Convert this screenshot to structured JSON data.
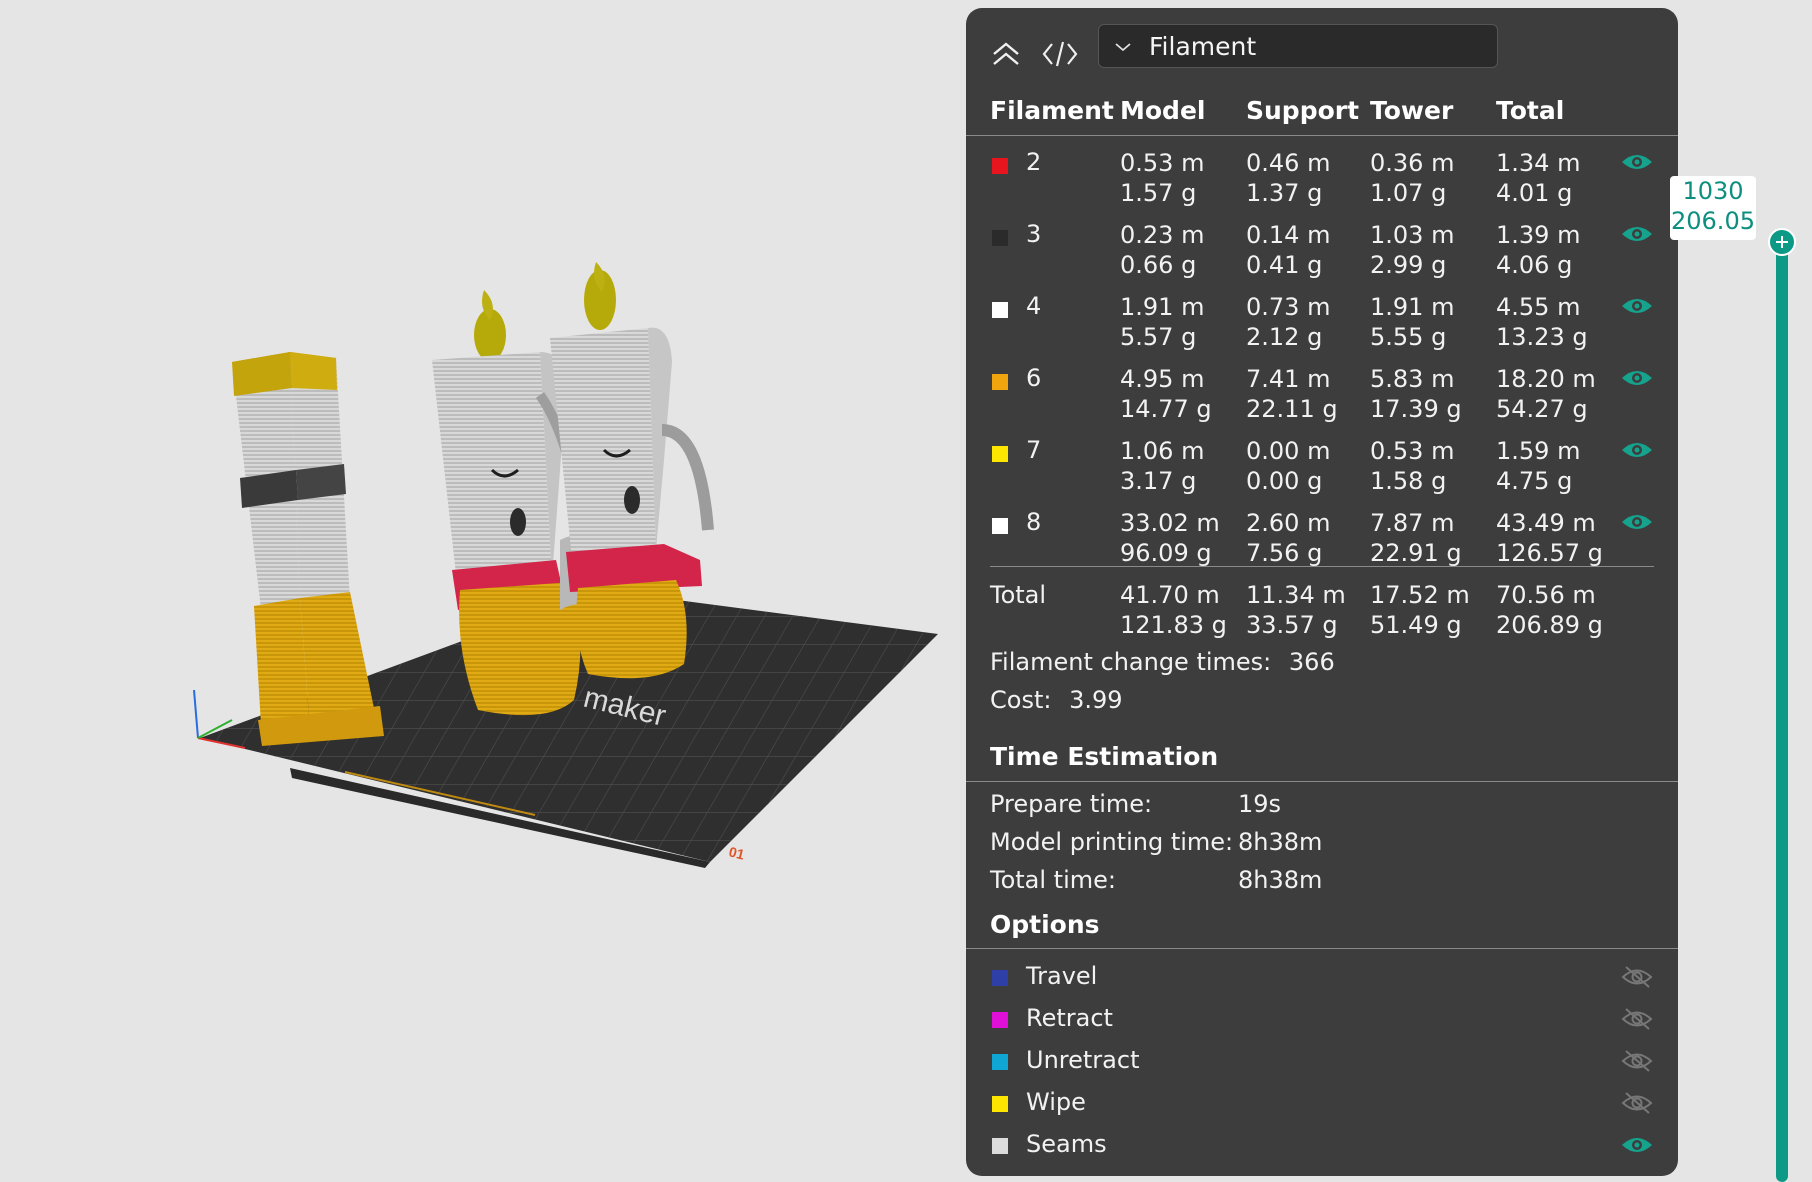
{
  "viewer": {
    "bed_logo_text": "maker",
    "bed_corner_label": "01"
  },
  "panel": {
    "view_mode": "Filament",
    "headers": {
      "filament": "Filament",
      "model": "Model",
      "support": "Support",
      "tower": "Tower",
      "total": "Total"
    },
    "filaments": [
      {
        "id": "2",
        "color": "#e8141e",
        "model_m": "0.53 m",
        "model_g": "1.57 g",
        "support_m": "0.46 m",
        "support_g": "1.37 g",
        "tower_m": "0.36 m",
        "tower_g": "1.07 g",
        "total_m": "1.34 m",
        "total_g": "4.01 g",
        "icon": "eye-icon"
      },
      {
        "id": "3",
        "color": "#2b2b2b",
        "model_m": "0.23 m",
        "model_g": "0.66 g",
        "support_m": "0.14 m",
        "support_g": "0.41 g",
        "tower_m": "1.03 m",
        "tower_g": "2.99 g",
        "total_m": "1.39 m",
        "total_g": "4.06 g",
        "icon": "eye-icon"
      },
      {
        "id": "4",
        "color": "#ffffff",
        "model_m": "1.91 m",
        "model_g": "5.57 g",
        "support_m": "0.73 m",
        "support_g": "2.12 g",
        "tower_m": "1.91 m",
        "tower_g": "5.55 g",
        "total_m": "4.55 m",
        "total_g": "13.23 g",
        "icon": "eye-icon"
      },
      {
        "id": "6",
        "color": "#f0a40e",
        "model_m": "4.95 m",
        "model_g": "14.77 g",
        "support_m": "7.41 m",
        "support_g": "22.11 g",
        "tower_m": "5.83 m",
        "tower_g": "17.39 g",
        "total_m": "18.20 m",
        "total_g": "54.27 g",
        "icon": "eye-icon"
      },
      {
        "id": "7",
        "color": "#ffe600",
        "model_m": "1.06 m",
        "model_g": "3.17 g",
        "support_m": "0.00 m",
        "support_g": "0.00 g",
        "tower_m": "0.53 m",
        "tower_g": "1.58 g",
        "total_m": "1.59 m",
        "total_g": "4.75 g",
        "icon": "eye-icon"
      },
      {
        "id": "8",
        "color": "#ffffff",
        "model_m": "33.02 m",
        "model_g": "96.09 g",
        "support_m": "2.60 m",
        "support_g": "7.56 g",
        "tower_m": "7.87 m",
        "tower_g": "22.91 g",
        "total_m": "43.49 m",
        "total_g": "126.57 g",
        "icon": "eye-icon"
      }
    ],
    "totals": {
      "label": "Total",
      "model_m": "41.70 m",
      "model_g": "121.83 g",
      "support_m": "11.34 m",
      "support_g": "33.57 g",
      "tower_m": "17.52 m",
      "tower_g": "51.49 g",
      "total_m": "70.56 m",
      "total_g": "206.89 g"
    },
    "filament_change_label": "Filament change times:",
    "filament_change_value": "366",
    "cost_label": "Cost:",
    "cost_value": "3.99",
    "time_estimation": {
      "title": "Time Estimation",
      "prepare_label": "Prepare time:",
      "prepare_value": "19s",
      "model_label": "Model printing time:",
      "model_value": "8h38m",
      "total_label": "Total time:",
      "total_value": "8h38m"
    },
    "options": {
      "title": "Options",
      "items": [
        {
          "name": "Travel",
          "color": "#2f3fa8",
          "icon": "eye-hidden-icon"
        },
        {
          "name": "Retract",
          "color": "#e010d8",
          "icon": "eye-hidden-icon"
        },
        {
          "name": "Unretract",
          "color": "#10a6d4",
          "icon": "eye-hidden-icon"
        },
        {
          "name": "Wipe",
          "color": "#ffe600",
          "icon": "eye-hidden-icon"
        },
        {
          "name": "Seams",
          "color": "#dcdcdc",
          "icon": "eye-icon"
        }
      ]
    }
  },
  "layer_slider": {
    "layer": "1030",
    "height": "206.05",
    "accent": "#0c9a86"
  }
}
